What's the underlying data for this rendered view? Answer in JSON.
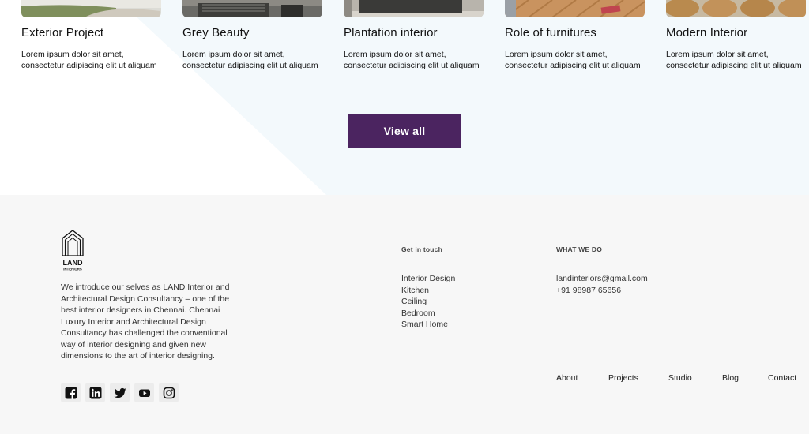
{
  "projects": [
    {
      "title": "Exterior Project",
      "desc": "Lorem ipsum dolor sit amet, consectetur adipiscing elit ut aliquam"
    },
    {
      "title": "Grey Beauty",
      "desc": "Lorem ipsum dolor sit amet, consectetur adipiscing elit ut aliquam"
    },
    {
      "title": "Plantation interior",
      "desc": "Lorem ipsum dolor sit amet, consectetur adipiscing elit ut aliquam"
    },
    {
      "title": "Role of furnitures",
      "desc": "Lorem ipsum dolor sit amet, consectetur adipiscing elit ut aliquam"
    },
    {
      "title": "Modern Interior",
      "desc": "Lorem ipsum dolor sit amet, consectetur adipiscing elit ut aliquam"
    }
  ],
  "view_all_label": "View all",
  "footer": {
    "logo_text": "LAND",
    "logo_subtext": "INTERIORS",
    "about": "We introduce our selves as LAND Interior and Architectural Design Consultancy – one of the best interior designers in Chennai. Chennai Luxury Interior and Architectural Design Consultancy has challenged the conventional way of interior designing and given new dimensions to the art of interior designing.",
    "get_in_touch": {
      "heading": "Get in touch",
      "items": [
        "Interior Design",
        "Kitchen",
        "Ceiling",
        "Bedroom",
        "Smart Home"
      ]
    },
    "what_we_do": {
      "heading": "WHAT WE DO",
      "email": "landinteriors@gmail.com",
      "phone": "+91 98987 65656"
    },
    "nav": [
      "About",
      "Projects",
      "Studio",
      "Blog",
      "Contact"
    ],
    "socials": [
      "facebook-icon",
      "linkedin-icon",
      "twitter-icon",
      "youtube-icon",
      "instagram-icon"
    ]
  },
  "colors": {
    "accent": "#4b2460",
    "diagonal": "#f3f9fc",
    "footer_bg": "#f7f7f7"
  }
}
